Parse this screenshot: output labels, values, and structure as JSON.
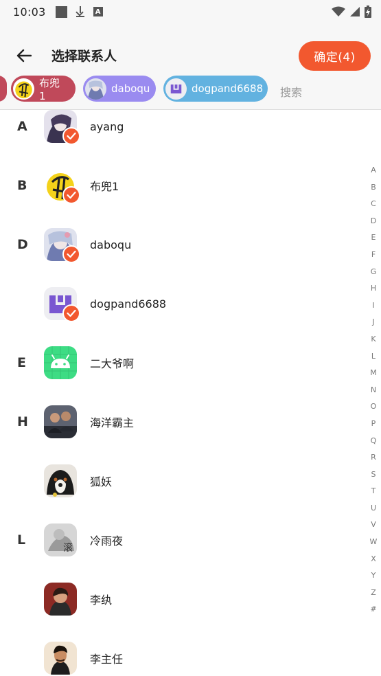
{
  "status_bar": {
    "time": "10:03",
    "icons": [
      "square-notification-icon",
      "download-icon",
      "a-notification-icon",
      "wifi-icon",
      "signal-icon",
      "battery-charging-icon"
    ]
  },
  "header": {
    "title": "选择联系人",
    "confirm_label": "确定(4)",
    "accent_color": "#f2582f"
  },
  "chips": [
    {
      "label": "布兜1",
      "color": "#c0495a"
    },
    {
      "label": "daboqu",
      "color": "#9a8bf0"
    },
    {
      "label": "dogpand6688",
      "color": "#62b2e0"
    }
  ],
  "search_placeholder": "搜索",
  "contacts": [
    {
      "letter": "A",
      "name": "ayang",
      "selected": true
    },
    {
      "letter": "B",
      "name": "布兜1",
      "selected": true
    },
    {
      "letter": "D",
      "name": "daboqu",
      "selected": true
    },
    {
      "letter": "",
      "name": "dogpand6688",
      "selected": true
    },
    {
      "letter": "E",
      "name": "二大爷啊",
      "selected": false
    },
    {
      "letter": "H",
      "name": "海洋霸主",
      "selected": false
    },
    {
      "letter": "",
      "name": "狐妖",
      "selected": false
    },
    {
      "letter": "L",
      "name": "冷雨夜",
      "selected": false
    },
    {
      "letter": "",
      "name": "李纨",
      "selected": false
    },
    {
      "letter": "",
      "name": "李主任",
      "selected": false
    }
  ],
  "avatar_overlay_text": "滚",
  "index_letters": [
    "A",
    "B",
    "C",
    "D",
    "E",
    "F",
    "G",
    "H",
    "I",
    "J",
    "K",
    "L",
    "M",
    "N",
    "O",
    "P",
    "Q",
    "R",
    "S",
    "T",
    "U",
    "V",
    "W",
    "X",
    "Y",
    "Z",
    "#"
  ]
}
